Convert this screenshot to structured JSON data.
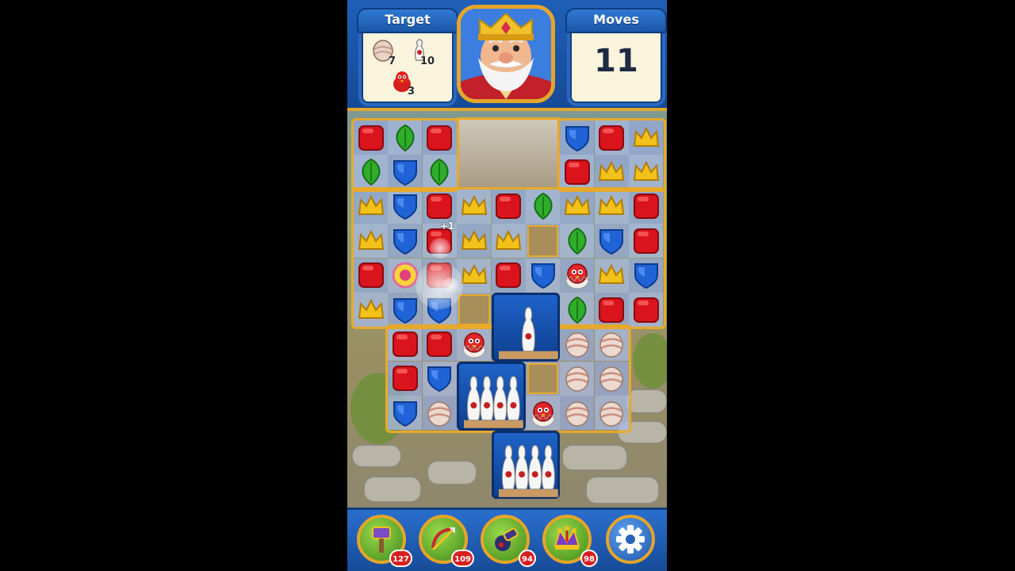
{
  "hud": {
    "target_label": "Target",
    "moves_label": "Moves",
    "moves_value": "11",
    "targets": [
      {
        "icon": "egg-icon",
        "count": "7"
      },
      {
        "icon": "bowling-pin-icon",
        "count": "10"
      },
      {
        "icon": "red-bird-icon",
        "count": "3"
      }
    ]
  },
  "board_effect": {
    "text": "+1"
  },
  "boosters": [
    {
      "name": "hammer-booster",
      "count": "127"
    },
    {
      "name": "arrow-booster",
      "count": "109"
    },
    {
      "name": "cannon-booster",
      "count": "94"
    },
    {
      "name": "jester-hat-booster",
      "count": "98"
    }
  ],
  "colors": {
    "red": "#d9141c",
    "green": "#2fae2a",
    "blue": "#1f63d6",
    "yellow": "#f2c21a",
    "frame": "#e8a92a"
  }
}
